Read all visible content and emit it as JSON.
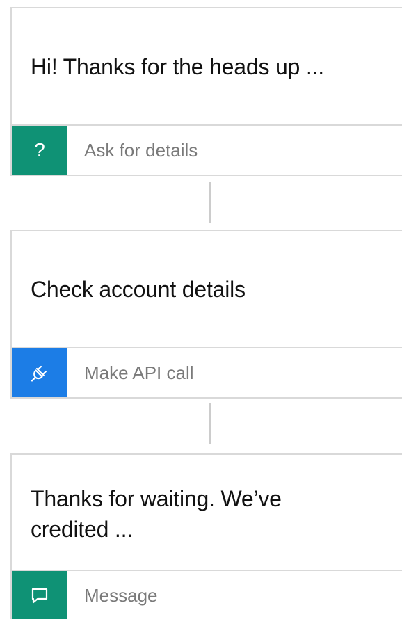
{
  "steps": [
    {
      "text": "Hi! Thanks for the heads up ...",
      "type_label": "Ask for details",
      "icon": "question-icon",
      "icon_glyph": "?",
      "color": "#0f9275"
    },
    {
      "text": "Check account details",
      "type_label": "Make API call",
      "icon": "plug-icon",
      "color": "#1c7de6"
    },
    {
      "text": "Thanks for waiting. We’ve credited ...",
      "type_label": "Message",
      "icon": "chat-bubble-icon",
      "color": "#0f9275"
    }
  ]
}
